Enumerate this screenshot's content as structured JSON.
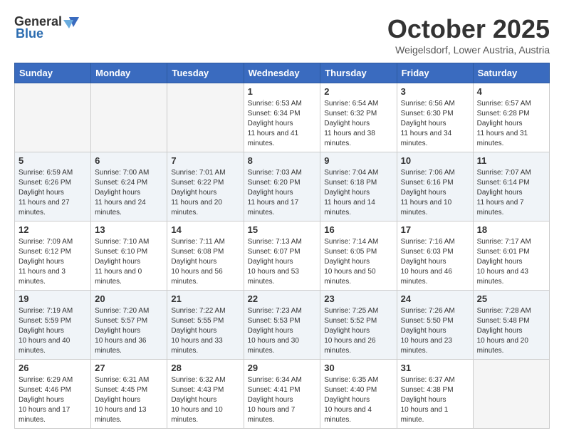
{
  "header": {
    "logo_general": "General",
    "logo_blue": "Blue",
    "title": "October 2025",
    "location": "Weigelsdorf, Lower Austria, Austria"
  },
  "days_of_week": [
    "Sunday",
    "Monday",
    "Tuesday",
    "Wednesday",
    "Thursday",
    "Friday",
    "Saturday"
  ],
  "weeks": [
    {
      "alt": false,
      "days": [
        {
          "num": "",
          "empty": true
        },
        {
          "num": "",
          "empty": true
        },
        {
          "num": "",
          "empty": true
        },
        {
          "num": "1",
          "sunrise": "6:53 AM",
          "sunset": "6:34 PM",
          "daylight": "11 hours and 41 minutes."
        },
        {
          "num": "2",
          "sunrise": "6:54 AM",
          "sunset": "6:32 PM",
          "daylight": "11 hours and 38 minutes."
        },
        {
          "num": "3",
          "sunrise": "6:56 AM",
          "sunset": "6:30 PM",
          "daylight": "11 hours and 34 minutes."
        },
        {
          "num": "4",
          "sunrise": "6:57 AM",
          "sunset": "6:28 PM",
          "daylight": "11 hours and 31 minutes."
        }
      ]
    },
    {
      "alt": true,
      "days": [
        {
          "num": "5",
          "sunrise": "6:59 AM",
          "sunset": "6:26 PM",
          "daylight": "11 hours and 27 minutes."
        },
        {
          "num": "6",
          "sunrise": "7:00 AM",
          "sunset": "6:24 PM",
          "daylight": "11 hours and 24 minutes."
        },
        {
          "num": "7",
          "sunrise": "7:01 AM",
          "sunset": "6:22 PM",
          "daylight": "11 hours and 20 minutes."
        },
        {
          "num": "8",
          "sunrise": "7:03 AM",
          "sunset": "6:20 PM",
          "daylight": "11 hours and 17 minutes."
        },
        {
          "num": "9",
          "sunrise": "7:04 AM",
          "sunset": "6:18 PM",
          "daylight": "11 hours and 14 minutes."
        },
        {
          "num": "10",
          "sunrise": "7:06 AM",
          "sunset": "6:16 PM",
          "daylight": "11 hours and 10 minutes."
        },
        {
          "num": "11",
          "sunrise": "7:07 AM",
          "sunset": "6:14 PM",
          "daylight": "11 hours and 7 minutes."
        }
      ]
    },
    {
      "alt": false,
      "days": [
        {
          "num": "12",
          "sunrise": "7:09 AM",
          "sunset": "6:12 PM",
          "daylight": "11 hours and 3 minutes."
        },
        {
          "num": "13",
          "sunrise": "7:10 AM",
          "sunset": "6:10 PM",
          "daylight": "11 hours and 0 minutes."
        },
        {
          "num": "14",
          "sunrise": "7:11 AM",
          "sunset": "6:08 PM",
          "daylight": "10 hours and 56 minutes."
        },
        {
          "num": "15",
          "sunrise": "7:13 AM",
          "sunset": "6:07 PM",
          "daylight": "10 hours and 53 minutes."
        },
        {
          "num": "16",
          "sunrise": "7:14 AM",
          "sunset": "6:05 PM",
          "daylight": "10 hours and 50 minutes."
        },
        {
          "num": "17",
          "sunrise": "7:16 AM",
          "sunset": "6:03 PM",
          "daylight": "10 hours and 46 minutes."
        },
        {
          "num": "18",
          "sunrise": "7:17 AM",
          "sunset": "6:01 PM",
          "daylight": "10 hours and 43 minutes."
        }
      ]
    },
    {
      "alt": true,
      "days": [
        {
          "num": "19",
          "sunrise": "7:19 AM",
          "sunset": "5:59 PM",
          "daylight": "10 hours and 40 minutes."
        },
        {
          "num": "20",
          "sunrise": "7:20 AM",
          "sunset": "5:57 PM",
          "daylight": "10 hours and 36 minutes."
        },
        {
          "num": "21",
          "sunrise": "7:22 AM",
          "sunset": "5:55 PM",
          "daylight": "10 hours and 33 minutes."
        },
        {
          "num": "22",
          "sunrise": "7:23 AM",
          "sunset": "5:53 PM",
          "daylight": "10 hours and 30 minutes."
        },
        {
          "num": "23",
          "sunrise": "7:25 AM",
          "sunset": "5:52 PM",
          "daylight": "10 hours and 26 minutes."
        },
        {
          "num": "24",
          "sunrise": "7:26 AM",
          "sunset": "5:50 PM",
          "daylight": "10 hours and 23 minutes."
        },
        {
          "num": "25",
          "sunrise": "7:28 AM",
          "sunset": "5:48 PM",
          "daylight": "10 hours and 20 minutes."
        }
      ]
    },
    {
      "alt": false,
      "days": [
        {
          "num": "26",
          "sunrise": "6:29 AM",
          "sunset": "4:46 PM",
          "daylight": "10 hours and 17 minutes."
        },
        {
          "num": "27",
          "sunrise": "6:31 AM",
          "sunset": "4:45 PM",
          "daylight": "10 hours and 13 minutes."
        },
        {
          "num": "28",
          "sunrise": "6:32 AM",
          "sunset": "4:43 PM",
          "daylight": "10 hours and 10 minutes."
        },
        {
          "num": "29",
          "sunrise": "6:34 AM",
          "sunset": "4:41 PM",
          "daylight": "10 hours and 7 minutes."
        },
        {
          "num": "30",
          "sunrise": "6:35 AM",
          "sunset": "4:40 PM",
          "daylight": "10 hours and 4 minutes."
        },
        {
          "num": "31",
          "sunrise": "6:37 AM",
          "sunset": "4:38 PM",
          "daylight": "10 hours and 1 minute."
        },
        {
          "num": "",
          "empty": true
        }
      ]
    }
  ]
}
